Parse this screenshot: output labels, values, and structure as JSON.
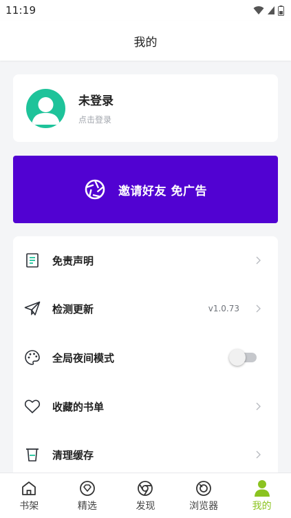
{
  "status_bar": {
    "time": "11:19"
  },
  "header": {
    "title": "我的"
  },
  "profile": {
    "name": "未登录",
    "subtitle": "点击登录"
  },
  "invite": {
    "label": "邀请好友 免广告"
  },
  "menu": {
    "disclaimer": "免责声明",
    "check_update": "检测更新",
    "version": "v1.0.73",
    "night_mode": "全局夜间模式",
    "favorites": "收藏的书单",
    "clear_cache": "清理缓存"
  },
  "nav": {
    "bookshelf": "书架",
    "featured": "精选",
    "discover": "发现",
    "browser": "浏览器",
    "mine": "我的"
  },
  "colors": {
    "accent_green": "#8bc320",
    "avatar_teal": "#1ec39a",
    "banner_purple": "#5102d2",
    "night_mode_toggle": "off"
  }
}
